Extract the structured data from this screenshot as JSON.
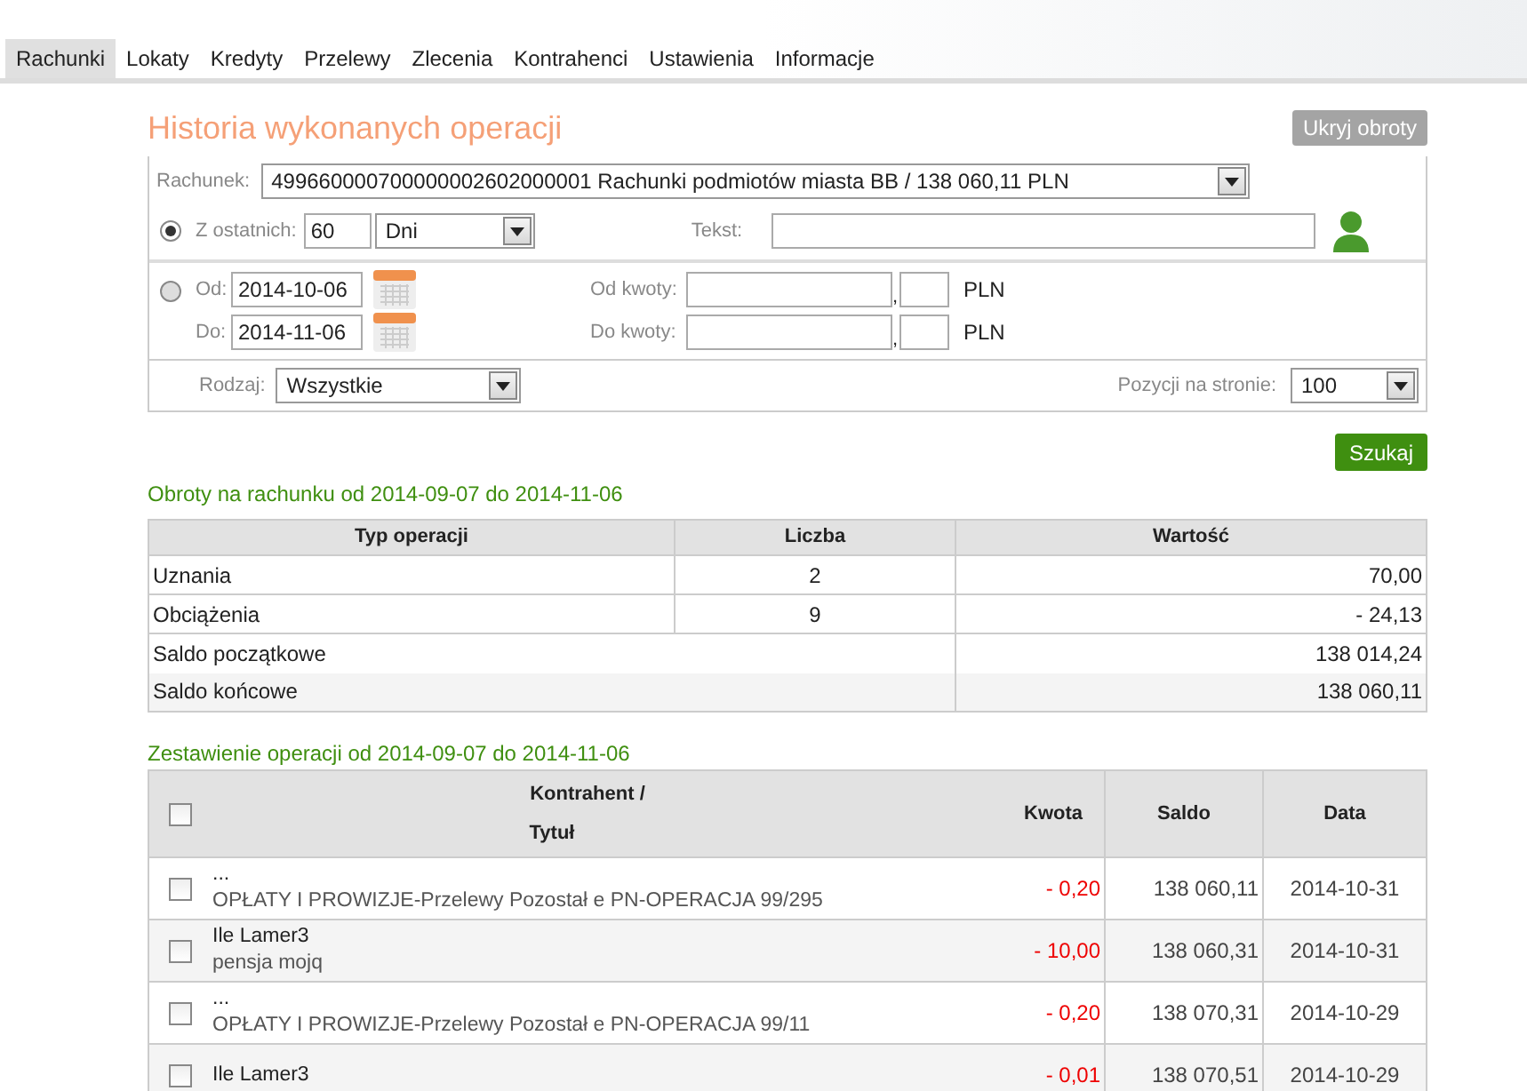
{
  "tabs": [
    {
      "label": "Rachunki",
      "selected": true
    },
    {
      "label": "Lokaty",
      "selected": false
    },
    {
      "label": "Kredyty",
      "selected": false
    },
    {
      "label": "Przelewy",
      "selected": false
    },
    {
      "label": "Zlecenia",
      "selected": false
    },
    {
      "label": "Kontrahenci",
      "selected": false
    },
    {
      "label": "Ustawienia",
      "selected": false
    },
    {
      "label": "Informacje",
      "selected": false
    }
  ],
  "page_title": "Historia wykonanych operacji",
  "hide_button": "Ukryj obroty",
  "filters": {
    "account_label": "Rachunek:",
    "account_value": "499660000700000002602000001 Rachunki podmiotów miasta BB / 138 060,11 PLN",
    "period": {
      "selected": true,
      "label": "Z ostatnich:",
      "value": "60",
      "unit": "Dni"
    },
    "text_label": "Tekst:",
    "range": {
      "selected": false,
      "from_label": "Od:",
      "from_value": "2014-10-06",
      "to_label": "Do:",
      "to_value": "2014-11-06"
    },
    "amounts": [
      {
        "label": "Od kwoty:",
        "separator": ",",
        "currency": "PLN"
      },
      {
        "label": "Do kwoty:",
        "separator": ",",
        "currency": "PLN"
      }
    ],
    "type_label": "Rodzaj:",
    "type_value": "Wszystkie",
    "per_page_label": "Pozycji na stronie:",
    "per_page_value": "100"
  },
  "search_button": "Szukaj",
  "summary": {
    "title": "Obroty na rachunku od 2014-09-07 do 2014-11-06",
    "columns": [
      "Typ operacji",
      "Liczba",
      "Wartość"
    ],
    "rows": [
      [
        "Uznania",
        "2",
        "70,00"
      ],
      [
        "Obciążenia",
        "9",
        "- 24,13"
      ]
    ],
    "balances": [
      [
        "Saldo początkowe",
        "138 014,24"
      ],
      [
        "Saldo końcowe",
        "138 060,11"
      ]
    ]
  },
  "operations": {
    "title": "Zestawienie operacji od 2014-09-07 do 2014-11-06",
    "select_all_checked": false,
    "columns": [
      "Kontrahent /",
      "Tytuł",
      "Kwota",
      "Saldo",
      "Data"
    ],
    "rows": [
      {
        "checked": false,
        "party": "...",
        "title": "OPŁATY I PROWIZJE-Przelewy Pozostał e PN-OPERACJA 99/295",
        "amount": "- 0,20",
        "balance": "138 060,11",
        "date": "2014-10-31"
      },
      {
        "checked": false,
        "party": "Ile Lamer3",
        "title": "pensja mojq",
        "amount": "- 10,00",
        "balance": "138 060,31",
        "date": "2014-10-31"
      },
      {
        "checked": false,
        "party": "...",
        "title": "OPŁATY I PROWIZJE-Przelewy Pozostał e PN-OPERACJA 99/11",
        "amount": "- 0,20",
        "balance": "138 070,31",
        "date": "2014-10-29"
      },
      {
        "checked": false,
        "party": "Ile Lamer3",
        "amount": "- 0,01",
        "balance": "138 070,51",
        "date": "2014-10-29"
      }
    ]
  }
}
